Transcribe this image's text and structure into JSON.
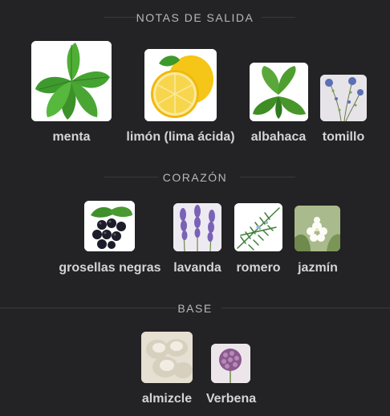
{
  "sections": [
    {
      "title": "NOTAS DE SALIDA",
      "items": [
        {
          "label": "menta",
          "icon": "mint-leaves-icon"
        },
        {
          "label": "limón (lima ácida)",
          "icon": "lemon-icon"
        },
        {
          "label": "albahaca",
          "icon": "basil-icon"
        },
        {
          "label": "tomillo",
          "icon": "thyme-icon"
        }
      ]
    },
    {
      "title": "CORAZÓN",
      "items": [
        {
          "label": "grosellas negras",
          "icon": "blackcurrant-icon"
        },
        {
          "label": "lavanda",
          "icon": "lavender-icon"
        },
        {
          "label": "romero",
          "icon": "rosemary-icon"
        },
        {
          "label": "jazmín",
          "icon": "jasmine-icon"
        }
      ]
    },
    {
      "title": "BASE",
      "items": [
        {
          "label": "almizcle",
          "icon": "musk-icon"
        },
        {
          "label": "Verbena",
          "icon": "verbena-icon"
        }
      ]
    }
  ],
  "colors": {
    "background": "#232224",
    "label": "#d4d4d6",
    "title": "#b8b8ba"
  }
}
